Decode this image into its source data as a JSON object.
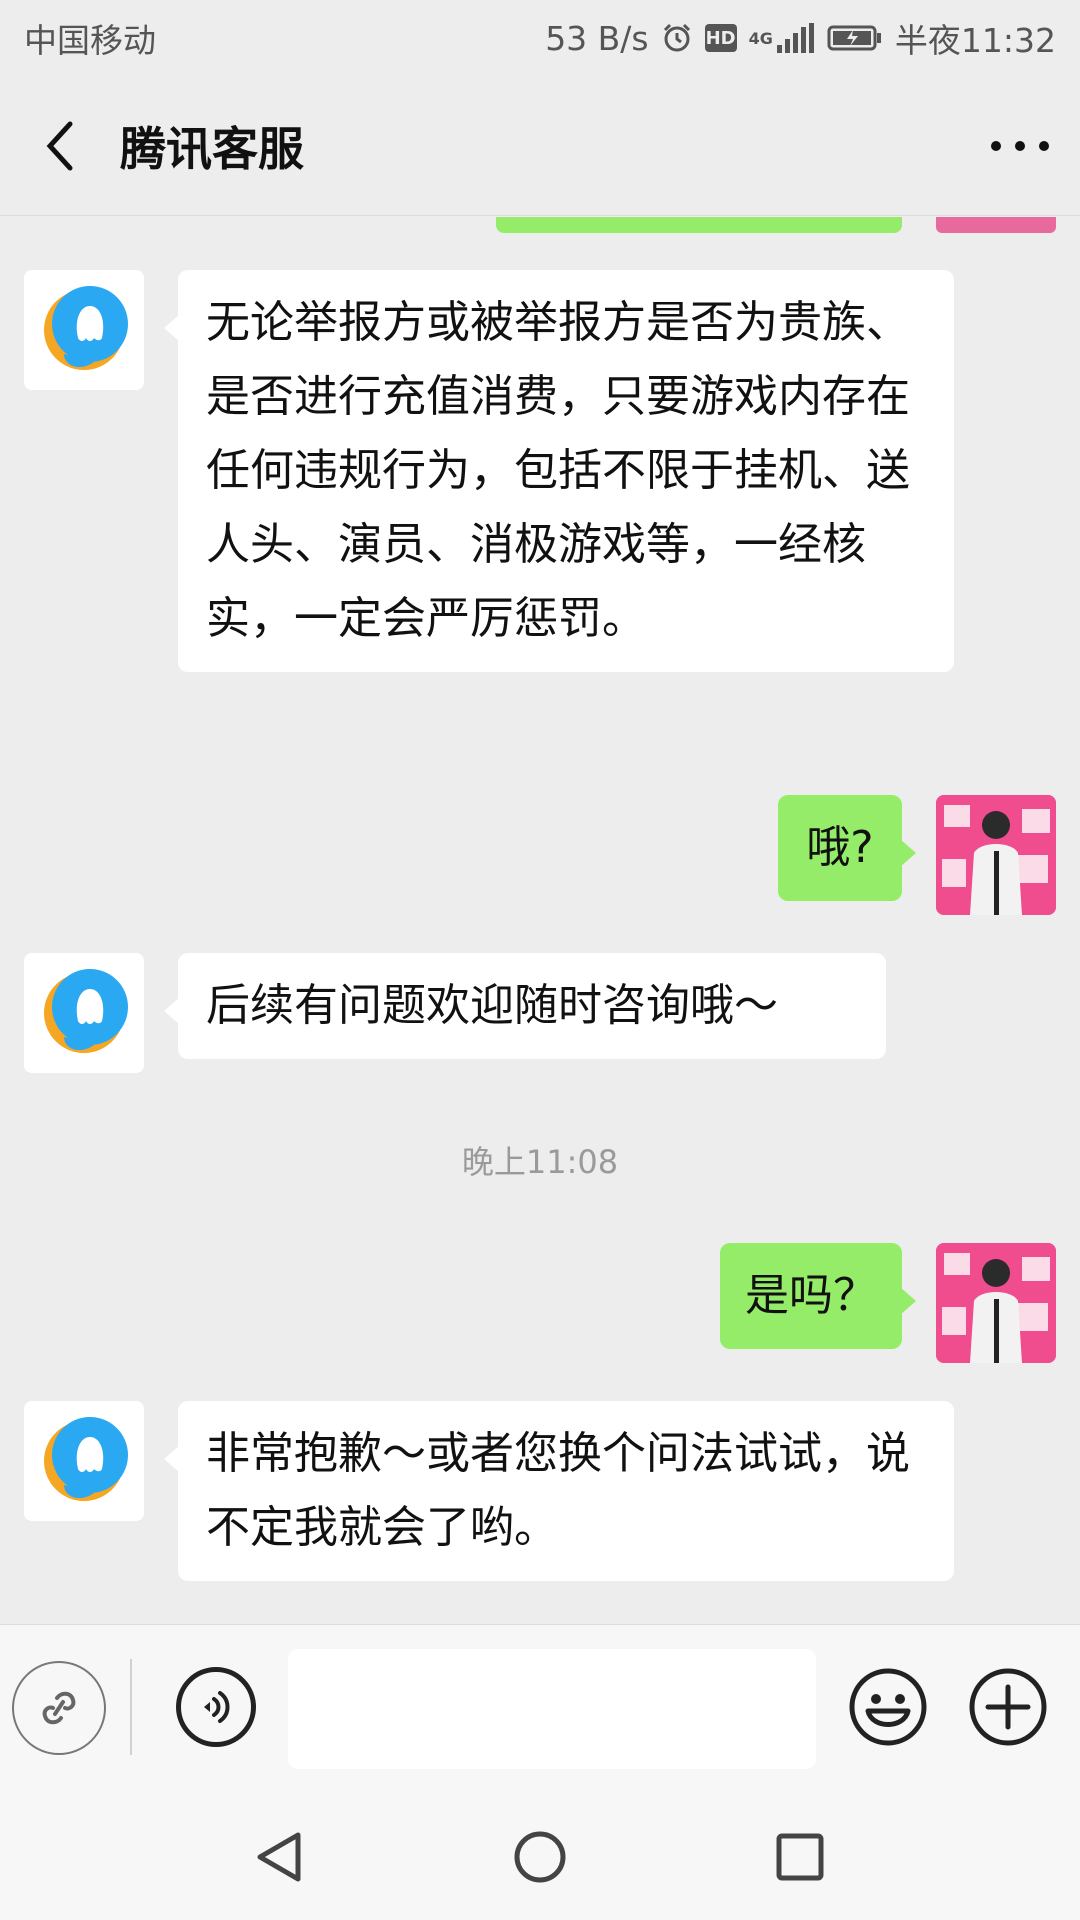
{
  "status_bar": {
    "carrier": "中国移动",
    "speed": "53 B/s",
    "hd_badge": "HD",
    "network": "4G",
    "time": "半夜11:32"
  },
  "header": {
    "title": "腾讯客服"
  },
  "messages": [
    {
      "side": "left",
      "text": "无论举报方或被举报方是否为贵族、是否进行充值消费，只要游戏内存在任何违规行为，包括不限于挂机、送人头、演员、消极游戏等，一经核实，一定会严厉惩罚。"
    },
    {
      "side": "right",
      "text": "哦?"
    },
    {
      "side": "left",
      "text": "后续有问题欢迎随时咨询哦～"
    },
    {
      "side": "right",
      "text": "是吗？"
    },
    {
      "side": "left",
      "text": "非常抱歉～或者您换个问法试试，说不定我就会了哟。"
    }
  ],
  "timestamp": "晚上11:08",
  "input": {
    "value": "",
    "placeholder": ""
  },
  "icons": {
    "back": "back-arrow-icon",
    "more": "more-dots-icon",
    "mini_program": "link-icon",
    "voice": "voice-icon",
    "emoji": "emoji-icon",
    "plus": "plus-icon",
    "nav_back": "triangle-back-icon",
    "nav_home": "circle-home-icon",
    "nav_recent": "square-recent-icon"
  },
  "colors": {
    "background": "#ededed",
    "sent_bubble": "#95ec69",
    "received_bubble": "#ffffff",
    "timestamp": "#9a9a9a"
  }
}
